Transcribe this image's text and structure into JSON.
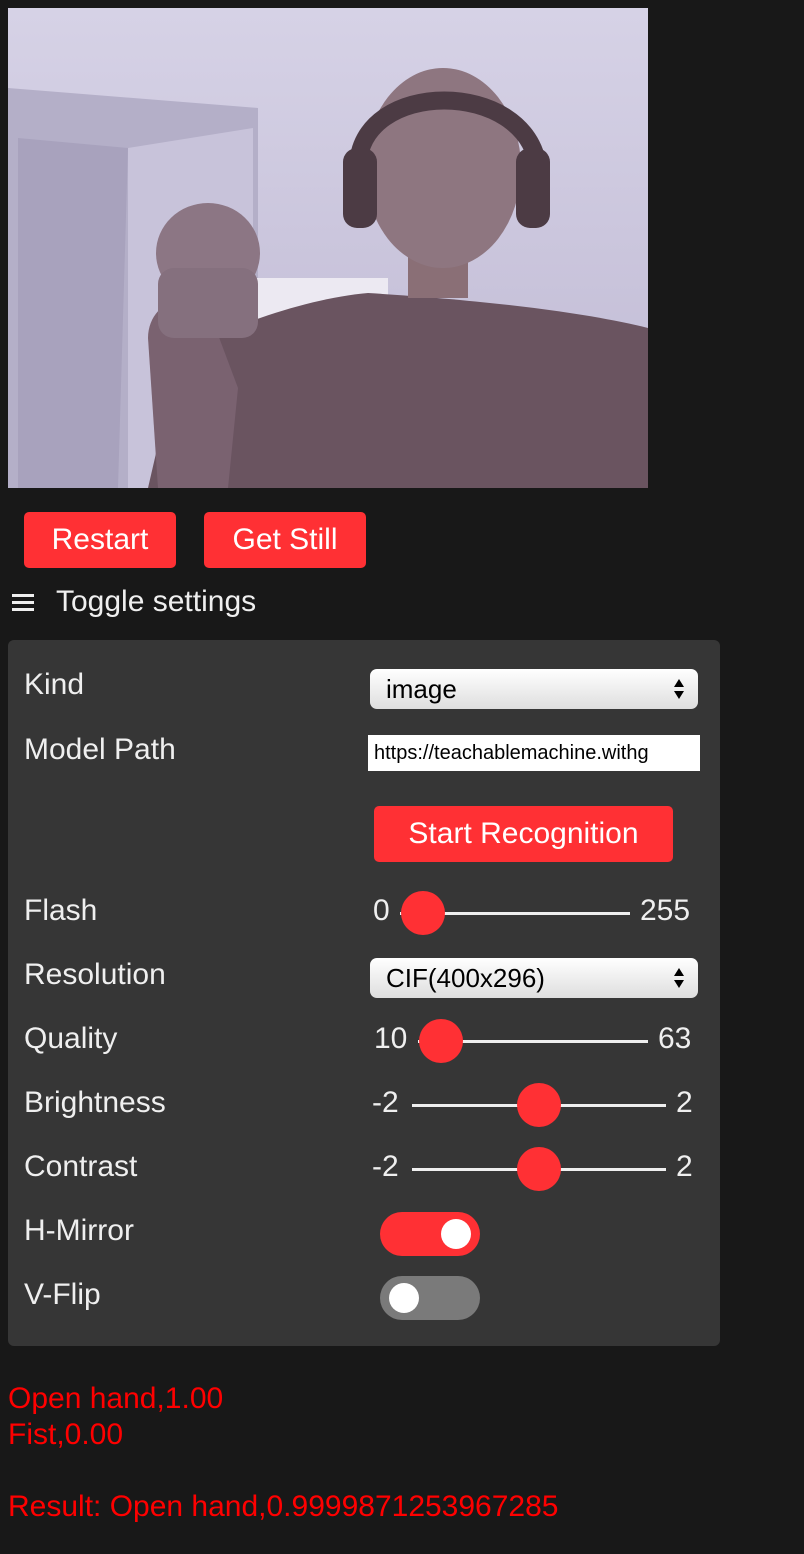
{
  "controls": {
    "restart_label": "Restart",
    "get_still_label": "Get Still",
    "toggle_settings_label": "Toggle settings"
  },
  "settings": {
    "kind": {
      "label": "Kind",
      "value": "image"
    },
    "model_path": {
      "label": "Model Path",
      "value": "https://teachablemachine.withg"
    },
    "start_recognition_label": "Start Recognition",
    "flash": {
      "label": "Flash",
      "min": "0",
      "max": "255",
      "value": 0
    },
    "resolution": {
      "label": "Resolution",
      "value": "CIF(400x296)"
    },
    "quality": {
      "label": "Quality",
      "min": "10",
      "max": "63",
      "value": 10
    },
    "brightness": {
      "label": "Brightness",
      "min": "-2",
      "max": "2",
      "value": 0
    },
    "contrast": {
      "label": "Contrast",
      "min": "-2",
      "max": "2",
      "value": 0
    },
    "hmirror": {
      "label": "H-Mirror",
      "checked": true
    },
    "vflip": {
      "label": "V-Flip",
      "checked": false
    }
  },
  "results": {
    "line1": "Open hand,1.00",
    "line2": "Fist,0.00",
    "result": "Result: Open hand,0.9999871253967285"
  },
  "colors": {
    "accent": "#ff3034",
    "background": "#181818",
    "panel": "#363636",
    "result_text": "#ff0000"
  }
}
